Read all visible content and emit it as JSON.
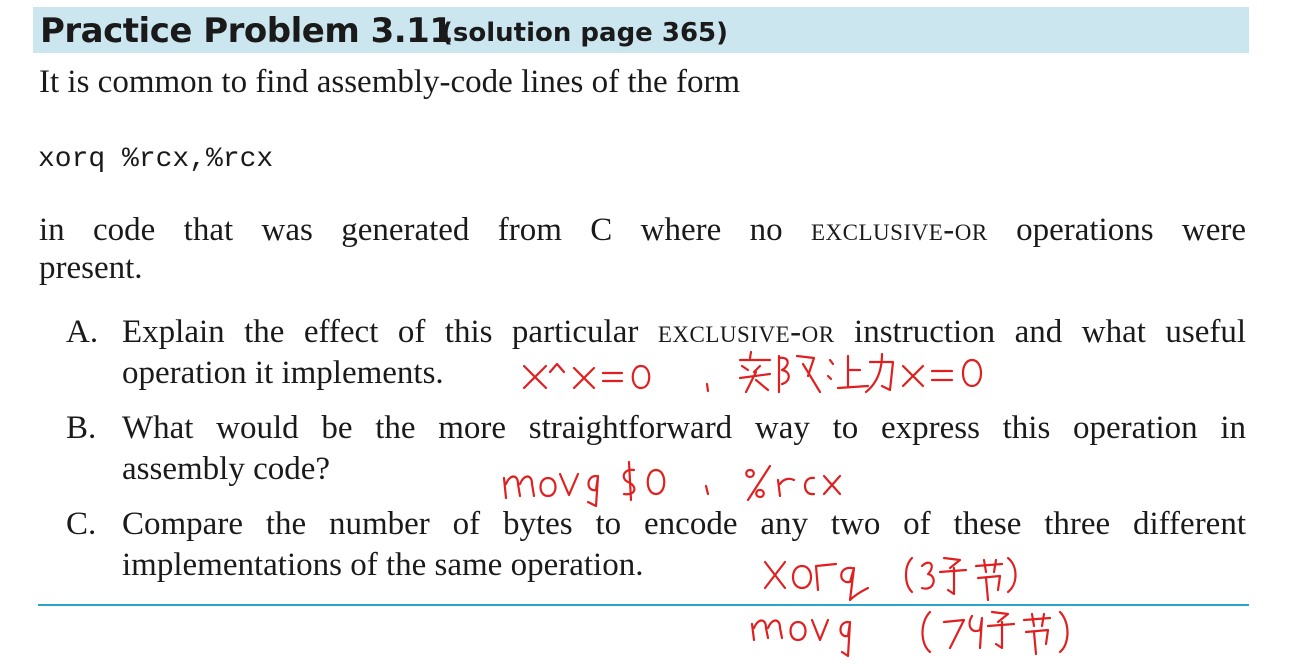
{
  "header": {
    "title": "Practice Problem 3.11",
    "subtitle": "(solution page 365)"
  },
  "intro": "It is common to find assembly-code lines of the form",
  "code_line": "xorq %rcx,%rcx",
  "body": {
    "part1": "in code that was generated from C where no",
    "smallcaps": "exclusive-or",
    "part2": "operations were",
    "line2": "present."
  },
  "questions": [
    {
      "label": "A.",
      "line1_pre": "Explain the effect of this particular",
      "line1_sc": "exclusive-or",
      "line1_post": "instruction and what useful",
      "line2": "operation it implements."
    },
    {
      "label": "B.",
      "line1": "What would be the more straightforward way to express this operation in",
      "line2": "assembly code?"
    },
    {
      "label": "C.",
      "line1": "Compare the number of bytes to encode any two of these three different",
      "line2": "implementations of the same operation."
    }
  ],
  "handwritten_notes": [
    "x^x=0 , 实际上为x=0",
    "movq $0 , %rcx",
    "xorq (3字节)",
    "movq (7字节)"
  ],
  "colors": {
    "header_bg": "#cce6f0",
    "rule": "#2aa6c4",
    "annotation_ink": "#e02020"
  }
}
